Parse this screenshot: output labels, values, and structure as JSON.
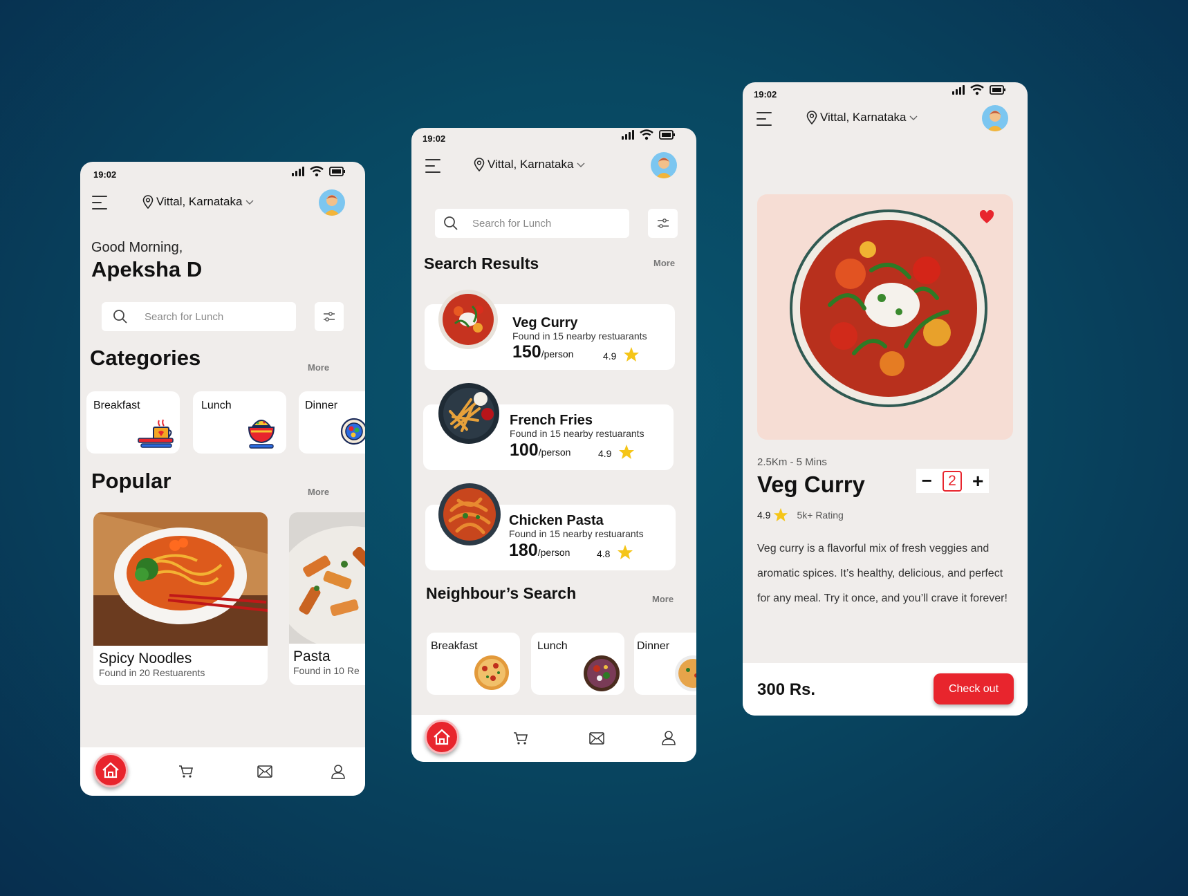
{
  "common": {
    "time": "19:02",
    "location": "Vittal, Karnataka"
  },
  "screen1": {
    "greeting": "Good Morning,",
    "user_name": "Apeksha D",
    "search_placeholder": "Search for Lunch",
    "categories_title": "Categories",
    "more": "More",
    "categories": [
      {
        "label": "Breakfast"
      },
      {
        "label": "Lunch"
      },
      {
        "label": "Dinner"
      }
    ],
    "popular_title": "Popular",
    "popular": [
      {
        "name": "Spicy Noodles",
        "sub": "Found in 20 Restuarents"
      },
      {
        "name": "Pasta",
        "sub": "Found in 10 Re"
      }
    ]
  },
  "screen2": {
    "search_placeholder": "Search for Lunch",
    "results_title": "Search Results",
    "more": "More",
    "results": [
      {
        "name": "Veg Curry",
        "sub": "Found in 15 nearby restuarants",
        "price": "150",
        "unit": "/person",
        "rating": "4.9"
      },
      {
        "name": "French Fries",
        "sub": "Found in 15 nearby restuarants",
        "price": "100",
        "unit": "/person",
        "rating": "4.9"
      },
      {
        "name": "Chicken Pasta",
        "sub": "Found in 15 nearby restuarants",
        "price": "180",
        "unit": "/person",
        "rating": "4.8"
      }
    ],
    "neighbour_title": "Neighbour’s Search",
    "neighbour": [
      {
        "label": "Breakfast"
      },
      {
        "label": "Lunch"
      },
      {
        "label": "Dinner"
      }
    ]
  },
  "screen3": {
    "distance": "2.5Km - 5 Mins",
    "name": "Veg Curry",
    "quantity": "2",
    "minus": "−",
    "plus": "+",
    "rating": "4.9",
    "rating_count": "5k+ Rating",
    "description": "Veg curry is a flavorful mix of fresh veggies and aromatic spices. It’s healthy, delicious, and perfect for any meal. Try it once, and you’ll crave it forever!",
    "total": "300 Rs.",
    "checkout": "Check out"
  },
  "colors": {
    "accent": "#e8252d",
    "star": "#f5c518",
    "background": "#084862"
  },
  "icons": [
    "menu-icon",
    "location-pin-icon",
    "chevron-down-icon",
    "search-icon",
    "filter-icon",
    "home-icon",
    "cart-icon",
    "mail-icon",
    "user-icon",
    "star-icon",
    "heart-icon"
  ]
}
